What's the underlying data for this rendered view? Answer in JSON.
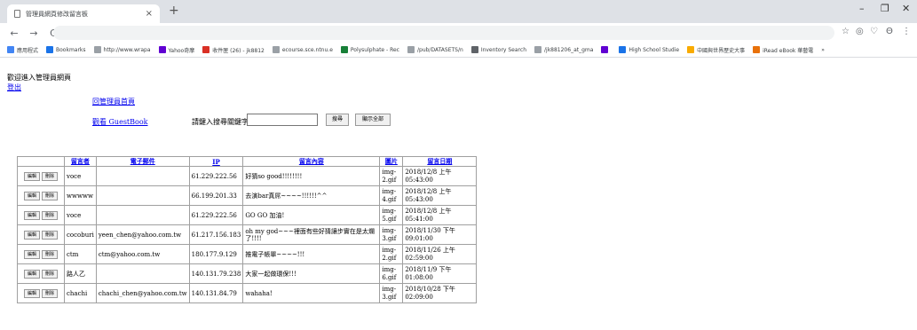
{
  "browser": {
    "tab_title": "管理員網頁修改留言板",
    "tab_close": "×",
    "new_tab": "+",
    "win_minimize": "–",
    "win_restore": "❐",
    "win_close": "✕",
    "nav_back": "←",
    "nav_forward": "→",
    "nav_reload": "C",
    "right_icons": [
      "☆",
      "◎",
      "♡",
      "Θ",
      "⋮"
    ],
    "bookmarks": [
      {
        "label": "應用程式",
        "icon": "apps-icon",
        "color": "#4285f4"
      },
      {
        "label": "Bookmarks",
        "icon": "star-icon",
        "color": "#1a73e8"
      },
      {
        "label": "http://www.wrapa",
        "icon": "page-icon",
        "color": "#9aa0a6"
      },
      {
        "label": "Yahoo奇摩",
        "icon": "yahoo-icon",
        "color": "#6001d2"
      },
      {
        "label": "收件匣 (26) - jk8812",
        "icon": "gmail-icon",
        "color": "#d93025"
      },
      {
        "label": "ecourse.sce.ntnu.e",
        "icon": "page-icon",
        "color": "#9aa0a6"
      },
      {
        "label": "Polysulphate - Rec",
        "icon": "drive-icon",
        "color": "#188038"
      },
      {
        "label": "/pub/DATASETS/n",
        "icon": "page-icon",
        "color": "#9aa0a6"
      },
      {
        "label": "Inventory Search",
        "icon": "inventory-icon",
        "color": "#5f6368"
      },
      {
        "label": "/jk881206_at_gma",
        "icon": "page-icon",
        "color": "#9aa0a6"
      },
      {
        "label": "",
        "icon": "yahoo-icon",
        "color": "#6001d2"
      },
      {
        "label": "High School Studie",
        "icon": "shield-icon",
        "color": "#1a73e8"
      },
      {
        "label": "中國與世界歷史大事",
        "icon": "bookmark-icon",
        "color": "#f9ab00"
      },
      {
        "label": "iRead eBook 華藝電",
        "icon": "iread-icon",
        "color": "#e8710a"
      },
      {
        "label": "»",
        "icon": "more-icon",
        "color": "#5f6368"
      }
    ]
  },
  "page": {
    "welcome": "歡迎進入管理員網頁",
    "logout": "登出",
    "back_admin": "回管理員首頁",
    "view_guestbook": "觀看 GuestBook",
    "search_label": "請鍵入搜尋關鍵字：",
    "search_value": "",
    "search_button": "搜尋",
    "show_all_button": "顯示全部"
  },
  "table": {
    "headers": [
      "",
      "留言者",
      "電子郵件",
      "IP",
      "留言內容",
      "圖片",
      "留言日期"
    ],
    "edit_label": "編輯",
    "delete_label": "刪除",
    "rows": [
      {
        "name": "voce",
        "email": "",
        "ip": "61.229.222.56",
        "message": "好猜so good!!!!!!!!",
        "img1": "img-",
        "img2": "2.gif",
        "date1": "2018/12/8 上午",
        "date2": "05:43:00"
      },
      {
        "name": "wwwww",
        "email": "",
        "ip": "66.199.201.33",
        "message": "去演bar真屌~~~~!!!!!!^^",
        "img1": "img-",
        "img2": "4.gif",
        "date1": "2018/12/8 上午",
        "date2": "05:43:00"
      },
      {
        "name": "voce",
        "email": "",
        "ip": "61.229.222.56",
        "message": "GO GO 加油!",
        "img1": "img-",
        "img2": "5.gif",
        "date1": "2018/12/8 上午",
        "date2": "05:41:00"
      },
      {
        "name": "cocoburi",
        "email": "yeen_chen@yahoo.com.tw",
        "ip": "61.217.156.183",
        "message": "oh my god~~~裡面有些好猜讓步實在是太爛了!!!!",
        "img1": "img-",
        "img2": "3.gif",
        "date1": "2018/11/30 下午",
        "date2": "09:01:00"
      },
      {
        "name": "ctm",
        "email": "ctm@yahoo.com.tw",
        "ip": "180.177.9.129",
        "message": "推電子帳單~~~~!!!",
        "img1": "img-",
        "img2": "2.gif",
        "date1": "2018/11/26 上午",
        "date2": "02:59:00"
      },
      {
        "name": "路人乙",
        "email": "",
        "ip": "140.131.79.238",
        "message": "大家一起做環保!!!",
        "img1": "img-",
        "img2": "6.gif",
        "date1": "2018/11/9 下午",
        "date2": "01:08:00"
      },
      {
        "name": "chachi",
        "email": "chachi_chen@yahoo.com.tw",
        "ip": "140.131.84.79",
        "message": "wahaha!",
        "img1": "img-",
        "img2": "3.gif",
        "date1": "2018/10/28 下午",
        "date2": "02:09:00"
      }
    ]
  }
}
